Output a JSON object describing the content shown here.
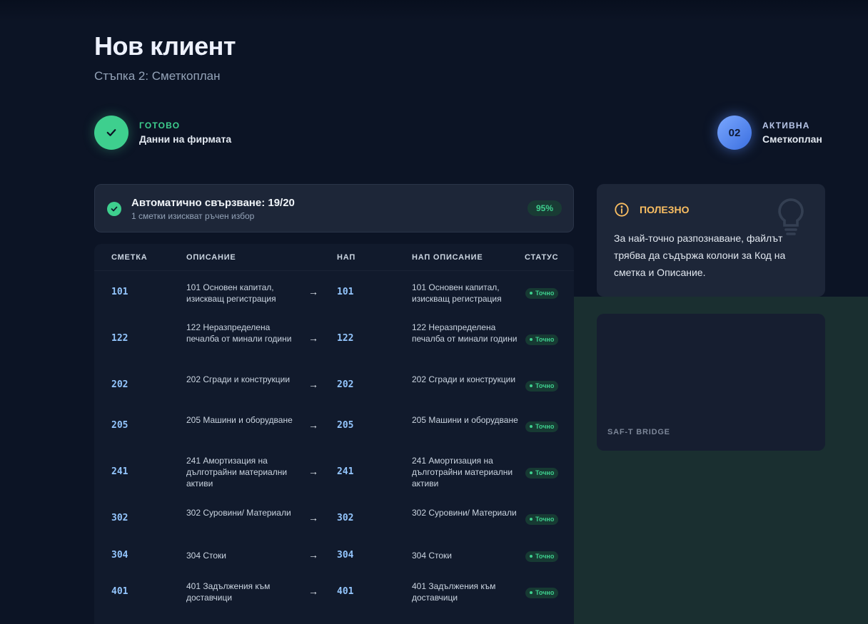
{
  "header": {
    "title": "Нов клиент",
    "subtitle": "Стъпка 2: Сметкоплан"
  },
  "steps": [
    {
      "status": "ГОТОВО",
      "label": "Данни на фирмата",
      "icon": "check-icon",
      "color": "#3ecf8e"
    },
    {
      "status": "АКТИВНА",
      "label": "Сметкоплан",
      "number": "02",
      "color": "#5b8df0"
    }
  ],
  "summary": {
    "title": "Автоматично свързване: 19/20",
    "subtitle": "1 сметки изискват ръчен избор",
    "percent": "95%"
  },
  "table": {
    "columns": [
      "СМЕТКА",
      "ОПИСАНИЕ",
      "НАП",
      "НАП ОПИСАНИЕ",
      "СТАТУС"
    ],
    "arrow": "→",
    "rows": [
      {
        "code": "101",
        "desc": "101 Основен капитал, изискващ регистрация",
        "nap": "101",
        "nap_desc": "101 Основен капитал, изискващ регистрация",
        "status": "Точно"
      },
      {
        "code": "122",
        "desc": "122 Неразпределена печалба от минали години",
        "nap": "122",
        "nap_desc": "122 Неразпределена печалба от минали години",
        "status": "Точно"
      },
      {
        "code": "202",
        "desc": "202 Сгради и конструкции",
        "nap": "202",
        "nap_desc": "202 Сгради и конструкции",
        "status": "Точно"
      },
      {
        "code": "205",
        "desc": "205 Машини и оборудване",
        "nap": "205",
        "nap_desc": "205 Машини и оборудване",
        "status": "Точно"
      },
      {
        "code": "241",
        "desc": "241 Амортизация на дълготрайни материални активи",
        "nap": "241",
        "nap_desc": "241 Амортизация на дълготрайни материални активи",
        "status": "Точно"
      },
      {
        "code": "302",
        "desc": "302 Суровини/ Материали",
        "nap": "302",
        "nap_desc": "302 Суровини/ Материали",
        "status": "Точно"
      },
      {
        "code": "304",
        "desc": "304 Стоки",
        "nap": "304",
        "nap_desc": "304 Стоки",
        "status": "Точно"
      },
      {
        "code": "401",
        "desc": "401 Задължения към доставчици",
        "nap": "401",
        "nap_desc": "401 Задължения към доставчици",
        "status": "Точно"
      }
    ]
  },
  "tip": {
    "title": "ПОЛЕЗНО",
    "body": "За най-точно разпознаване, файлът трябва да съдържа колони за Код на сметка и Описание.",
    "icon": "info-icon",
    "decor_icon": "lightbulb-icon",
    "color": "#fbbf62"
  },
  "bridge": {
    "label": "SAF-T BRIDGE"
  }
}
